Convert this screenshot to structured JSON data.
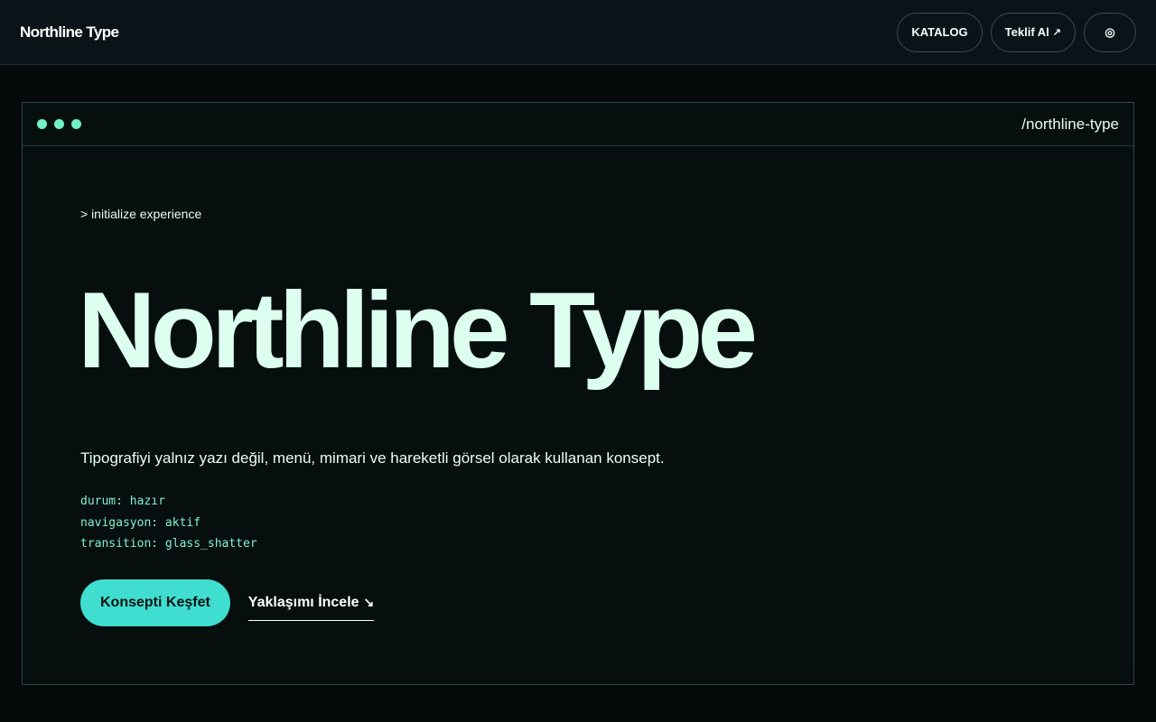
{
  "header": {
    "brand": "Northline Type",
    "nav": {
      "catalog_label": "KATALOG",
      "quote_label": "Teklif Al",
      "quote_icon": "↗",
      "toggle_icon": "◎"
    }
  },
  "window": {
    "path": "/northline-type",
    "dots": [
      "#6ff2c7",
      "#6ff2c7",
      "#6ff2c7"
    ]
  },
  "hero": {
    "prompt": "> initialize experience",
    "title": "Northline Type",
    "description": "Tipografiyi yalnız yazı değil, menü, mimari ve hareketli görsel olarak kullanan konsept.",
    "status_lines": [
      "durum: hazır",
      "navigasyon: aktif",
      "transition: glass_shatter"
    ],
    "primary_cta": "Konsepti Keşfet",
    "secondary_cta": "Yaklaşımı İncele",
    "secondary_icon": "↘"
  },
  "colors": {
    "accent": "#3fded0",
    "dot": "#6ff2c7",
    "background": "#050909"
  }
}
